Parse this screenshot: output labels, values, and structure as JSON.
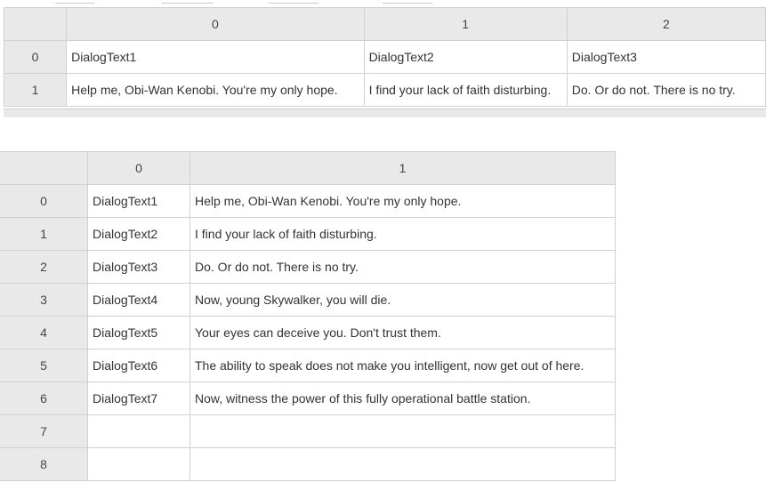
{
  "top_table": {
    "columns": [
      "0",
      "1",
      "2"
    ],
    "rows": [
      {
        "index": "0",
        "cells": [
          "DialogText1",
          "DialogText2",
          "DialogText3"
        ]
      },
      {
        "index": "1",
        "cells": [
          "Help me, Obi-Wan Kenobi. You're my only hope.",
          "I find your lack of faith disturbing.",
          "Do. Or do not. There is no try."
        ]
      }
    ]
  },
  "bottom_table": {
    "columns": [
      "0",
      "1"
    ],
    "rows": [
      {
        "index": "0",
        "cells": [
          "DialogText1",
          "Help me, Obi-Wan Kenobi. You're my only hope."
        ]
      },
      {
        "index": "1",
        "cells": [
          "DialogText2",
          "I find your lack of faith disturbing."
        ]
      },
      {
        "index": "2",
        "cells": [
          "DialogText3",
          "Do. Or do not. There is no try."
        ]
      },
      {
        "index": "3",
        "cells": [
          "DialogText4",
          "Now, young Skywalker, you will die."
        ]
      },
      {
        "index": "4",
        "cells": [
          "DialogText5",
          "Your eyes can deceive you. Don't trust them."
        ]
      },
      {
        "index": "5",
        "cells": [
          "DialogText6",
          "The ability to speak does not make you intelligent, now get out of here."
        ]
      },
      {
        "index": "6",
        "cells": [
          "DialogText7",
          "Now, witness the power of this fully operational battle station."
        ]
      },
      {
        "index": "7",
        "cells": [
          "",
          ""
        ]
      },
      {
        "index": "8",
        "cells": [
          "",
          ""
        ]
      }
    ]
  }
}
